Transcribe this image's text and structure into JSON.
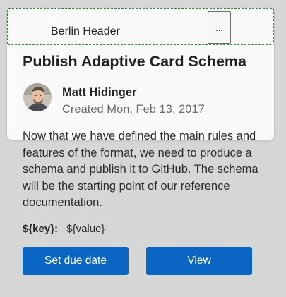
{
  "header": {
    "title": "Berlin Header",
    "more_label": "..."
  },
  "card": {
    "title": "Publish Adaptive Card Schema",
    "author": "Matt Hidinger",
    "created": "Created Mon, Feb 13, 2017",
    "body": "Now that we have defined the main rules and features of the format, we need to produce a schema and publish it to GitHub. The schema will be the starting point of our reference documentation.",
    "fact": {
      "key": "${key}:",
      "value": "${value}"
    }
  },
  "actions": {
    "due_label": "Set due date",
    "view_label": "View"
  },
  "colors": {
    "accent": "#0a66c2",
    "header_border": "#2e8b2e",
    "background": "#d6d6d6",
    "card": "#fafafa"
  },
  "icons": {
    "avatar": "person-avatar"
  }
}
